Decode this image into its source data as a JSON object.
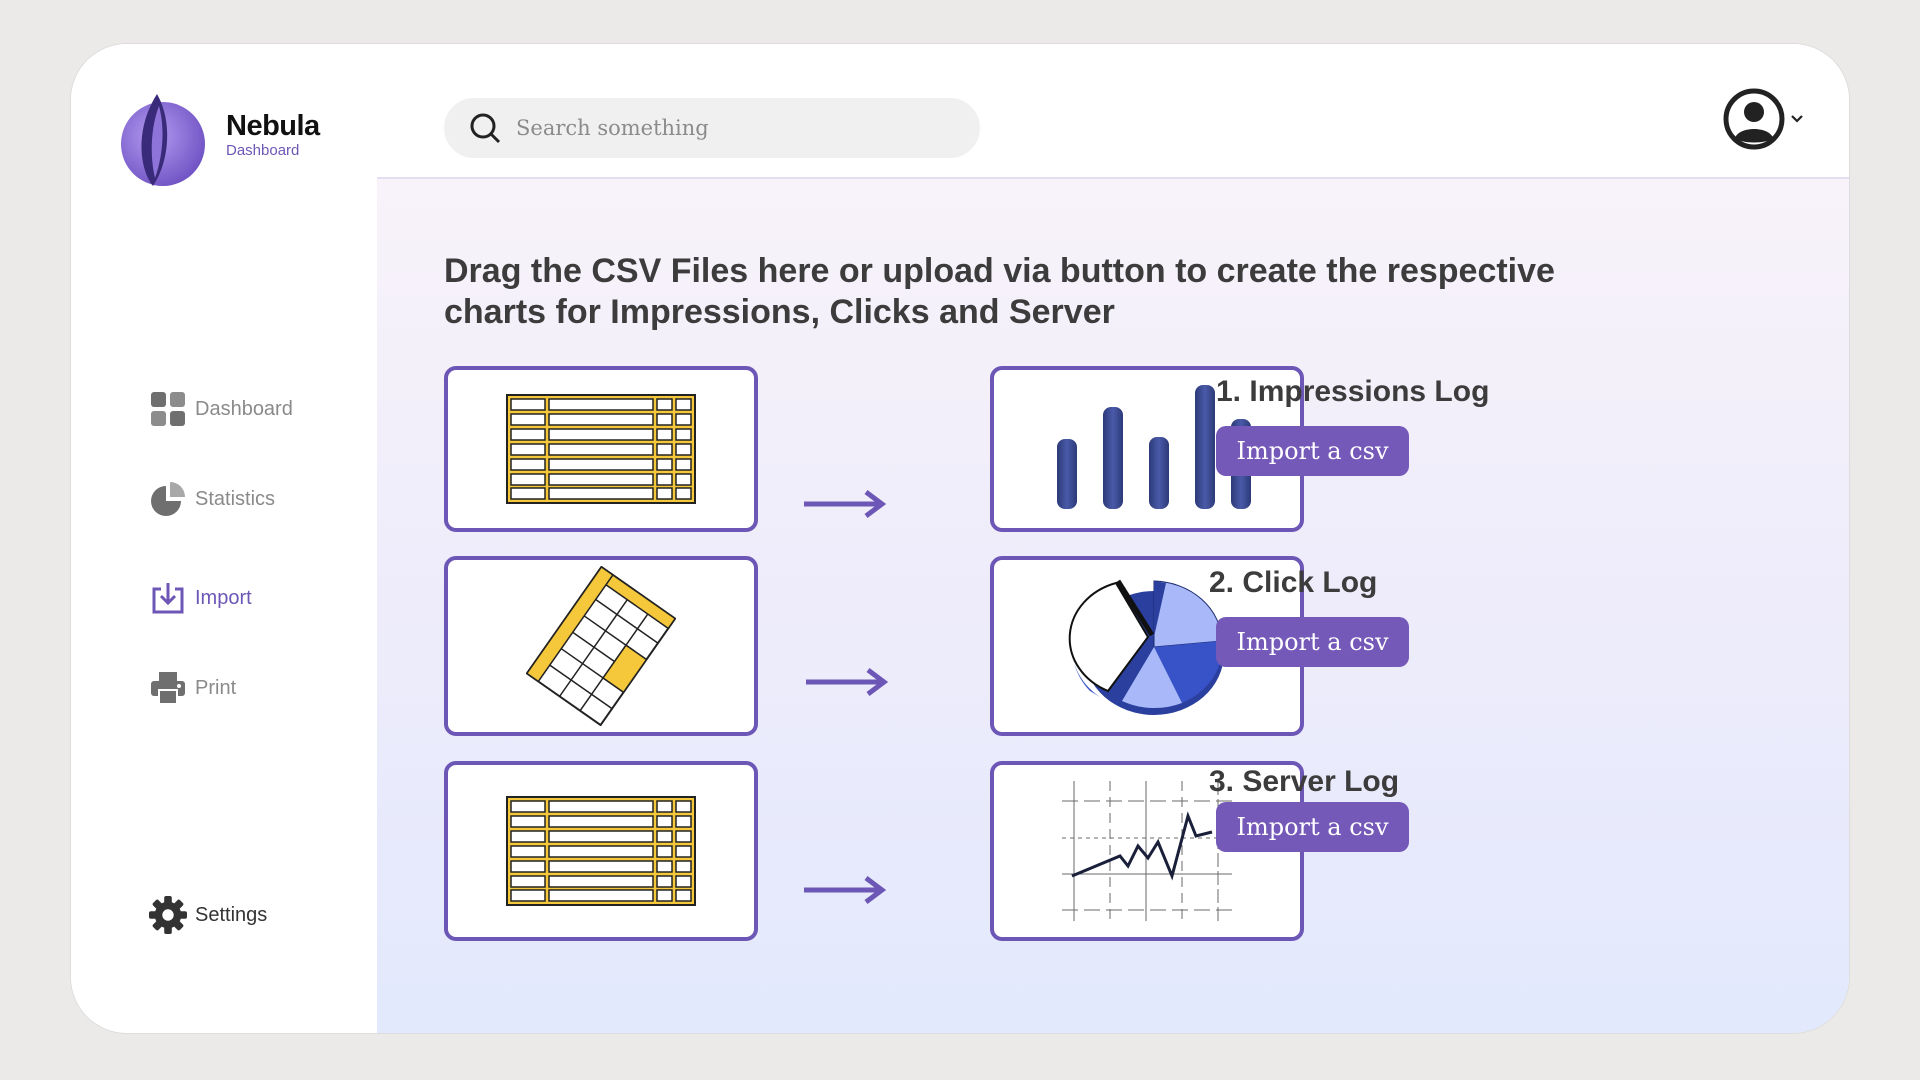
{
  "brand": {
    "name": "Nebula",
    "subtitle": "Dashboard"
  },
  "nav": {
    "dashboard": "Dashboard",
    "statistics": "Statistics",
    "import": "Import",
    "print": "Print",
    "settings": "Settings"
  },
  "search": {
    "placeholder": "Search something"
  },
  "main": {
    "heading": "Drag the CSV Files here or upload via button to create the respective charts for Impressions, Clicks and Server",
    "logs": [
      {
        "title": "1. Impressions Log",
        "button": "Import a csv"
      },
      {
        "title": "2. Click Log",
        "button": "Import a csv"
      },
      {
        "title": "3. Server Log",
        "button": "Import a csv"
      }
    ]
  },
  "colors": {
    "accent": "#6c57b6",
    "button": "#7559b9",
    "spreadsheet": "#f5c83b",
    "chart": "#3b4a8c"
  }
}
